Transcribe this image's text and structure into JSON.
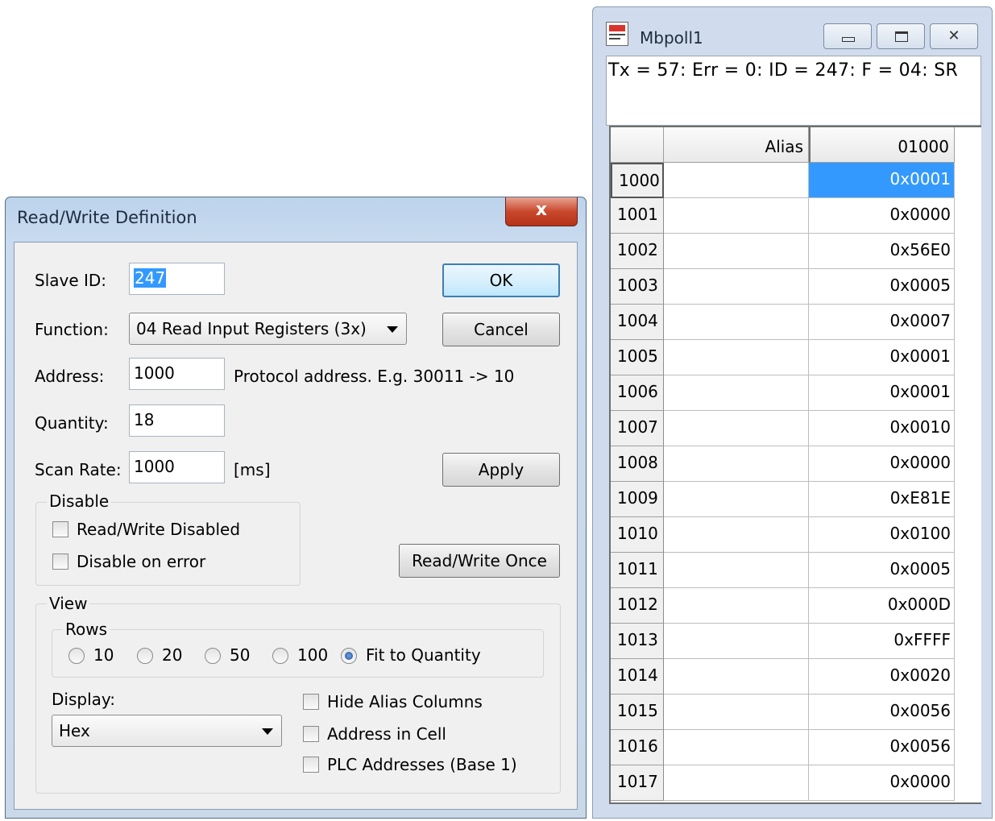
{
  "dialog": {
    "title": "Read/Write Definition",
    "close_glyph": "x",
    "slave_id": {
      "label": "Slave ID:",
      "value": "247"
    },
    "function": {
      "label": "Function:",
      "value": "04 Read Input Registers (3x)"
    },
    "address": {
      "label": "Address:",
      "value": "1000",
      "hint": "Protocol address. E.g. 30011 -> 10"
    },
    "quantity": {
      "label": "Quantity:",
      "value": "18"
    },
    "scan_rate": {
      "label": "Scan Rate:",
      "value": "1000",
      "unit": "[ms]"
    },
    "buttons": {
      "ok": "OK",
      "cancel": "Cancel",
      "apply": "Apply",
      "rw_once": "Read/Write Once"
    },
    "disable": {
      "group_label": "Disable",
      "rw_disabled": {
        "label": "Read/Write Disabled",
        "checked": false
      },
      "disable_on_error": {
        "label": "Disable on error",
        "checked": false
      }
    },
    "view": {
      "group_label": "View",
      "rows_label": "Rows",
      "rows_options": [
        "10",
        "20",
        "50",
        "100",
        "Fit to Quantity"
      ],
      "rows_selected": "Fit to Quantity",
      "display_label": "Display:",
      "display_value": "Hex",
      "hide_alias": {
        "label": "Hide Alias Columns",
        "checked": false
      },
      "address_in_cell": {
        "label": "Address in Cell",
        "checked": false
      },
      "plc_addresses": {
        "label": "PLC Addresses (Base 1)",
        "checked": false
      }
    }
  },
  "mbpoll": {
    "title": "Mbpoll1",
    "status": "Tx = 57: Err = 0: ID = 247: F = 04: SR",
    "columns": {
      "alias": "Alias",
      "value": "01000"
    },
    "rows": [
      {
        "addr": "1000",
        "alias": "",
        "value": "0x0001",
        "selected": true
      },
      {
        "addr": "1001",
        "alias": "",
        "value": "0x0000"
      },
      {
        "addr": "1002",
        "alias": "",
        "value": "0x56E0"
      },
      {
        "addr": "1003",
        "alias": "",
        "value": "0x0005"
      },
      {
        "addr": "1004",
        "alias": "",
        "value": "0x0007"
      },
      {
        "addr": "1005",
        "alias": "",
        "value": "0x0001"
      },
      {
        "addr": "1006",
        "alias": "",
        "value": "0x0001"
      },
      {
        "addr": "1007",
        "alias": "",
        "value": "0x0010"
      },
      {
        "addr": "1008",
        "alias": "",
        "value": "0x0000"
      },
      {
        "addr": "1009",
        "alias": "",
        "value": "0xE81E"
      },
      {
        "addr": "1010",
        "alias": "",
        "value": "0x0100"
      },
      {
        "addr": "1011",
        "alias": "",
        "value": "0x0005"
      },
      {
        "addr": "1012",
        "alias": "",
        "value": "0x000D"
      },
      {
        "addr": "1013",
        "alias": "",
        "value": "0xFFFF"
      },
      {
        "addr": "1014",
        "alias": "",
        "value": "0x0020"
      },
      {
        "addr": "1015",
        "alias": "",
        "value": "0x0056"
      },
      {
        "addr": "1016",
        "alias": "",
        "value": "0x0056"
      },
      {
        "addr": "1017",
        "alias": "",
        "value": "0x0000"
      }
    ]
  }
}
